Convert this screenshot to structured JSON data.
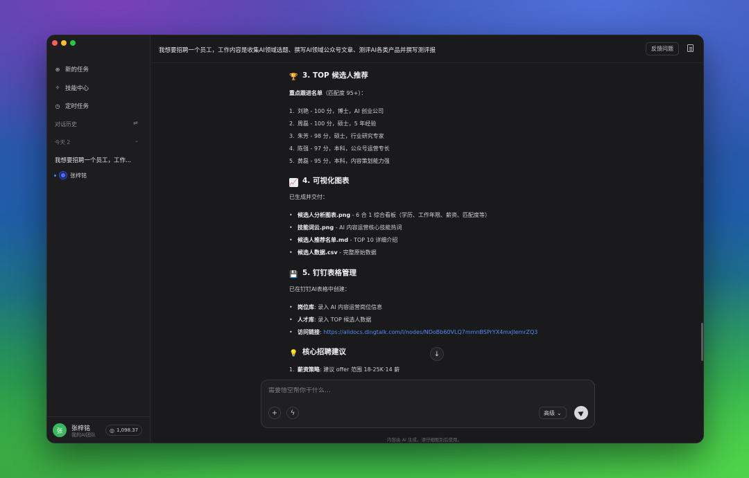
{
  "sidebar": {
    "nav": [
      {
        "icon": "plus-circle-icon",
        "glyph": "⊕",
        "label": "新的任务"
      },
      {
        "icon": "sparkle-icon",
        "glyph": "✧",
        "label": "技能中心"
      },
      {
        "icon": "clock-icon",
        "glyph": "◷",
        "label": "定时任务"
      }
    ],
    "history_title": "对话历史",
    "today_label": "今天 2",
    "conversation": "我想要招聘一个员工，工作...",
    "sub_item": "张梓铭",
    "profile": {
      "avatar_text": "张",
      "name": "张梓铭",
      "team": "我的AI团队",
      "credits": "1,098.37"
    }
  },
  "header": {
    "title": "我想要招聘一个员工，工作内容是收集AI领域选题、撰写AI领域公众号文章、测评AI各类产品并撰写测评报",
    "feedback_label": "反馈问题"
  },
  "content": {
    "section3": {
      "emoji": "🏆",
      "title": "3. TOP 候选人推荐",
      "intro_bold": "重点跟进名单",
      "intro_rest": "（匹配度 95+）：",
      "items": [
        {
          "num": "1.",
          "text": "刘艳 - 100 分，博士，AI 创业公司"
        },
        {
          "num": "2.",
          "text": "周磊 - 100 分，硕士，5 年经验"
        },
        {
          "num": "3.",
          "text": "朱芳 - 98 分，硕士，行业研究专家"
        },
        {
          "num": "4.",
          "text": "陈强 - 97 分，本科，公众号运营专长"
        },
        {
          "num": "5.",
          "text": "黄磊 - 95 分，本科，内容策划能力强"
        }
      ]
    },
    "section4": {
      "emoji": "📈",
      "title": "4. 可视化图表",
      "intro": "已生成并交付：",
      "items": [
        {
          "bold": "候选人分析图表.png",
          "rest": " - 6 合 1 综合看板（学历、工作年限、薪资、匹配度等）"
        },
        {
          "bold": "技能词云.png",
          "rest": " - AI 内容运营核心技能热词"
        },
        {
          "bold": "候选人推荐名单.md",
          "rest": " - TOP 10 详细介绍"
        },
        {
          "bold": "候选人数据.csv",
          "rest": " - 完整原始数据"
        }
      ]
    },
    "section5": {
      "emoji": "💾",
      "title": "5. 钉钉表格管理",
      "intro": "已在钉钉AI表格中创建：",
      "items": [
        {
          "bold": "岗位库",
          "rest": ": 录入 AI 内容运营岗位信息"
        },
        {
          "bold": "人才库",
          "rest": ": 录入 TOP 候选人数据"
        }
      ],
      "link_label": "访问链接",
      "link_url": "https://alidocs.dingtalk.com/i/nodes/NDoBb60VLQ7mmnBSPrYX4mxJlemrZQ3"
    },
    "section6": {
      "emoji": "💡",
      "title": "核心招聘建议",
      "items": [
        {
          "num": "1.",
          "bold": "薪资策略",
          "rest": ": 建议 offer 范围 18-25K·14 薪"
        }
      ]
    }
  },
  "composer": {
    "placeholder": "需要悟空帮你干什么...",
    "mode_label": "高级"
  },
  "disclaimer": "内容由 AI 生成，请仔细甄别后使用。"
}
